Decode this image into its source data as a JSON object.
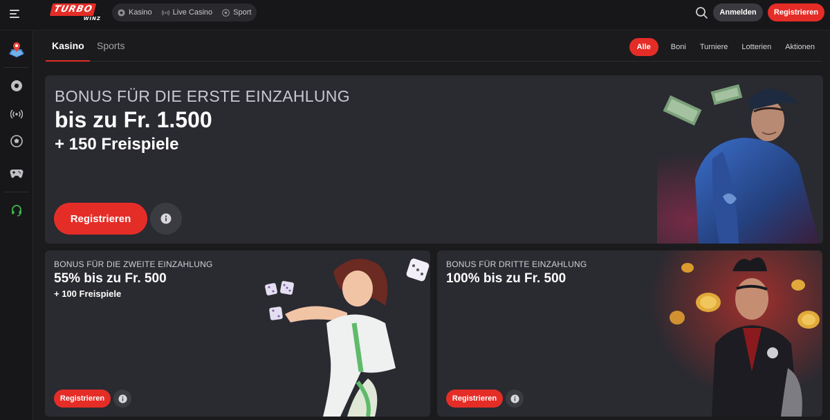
{
  "brand": {
    "logo_main": "TURBO",
    "logo_sub": "WINZ",
    "accent": "#e52d27"
  },
  "topnav": [
    {
      "label": "Kasino",
      "icon": "chip-icon"
    },
    {
      "label": "Live Casino",
      "icon": "broadcast-icon"
    },
    {
      "label": "Sport",
      "icon": "soccer-ball-icon"
    }
  ],
  "header": {
    "login_label": "Anmelden",
    "register_label": "Registrieren"
  },
  "sidebar": {
    "items": [
      {
        "icon": "map-pin-icon"
      },
      {
        "icon": "chip-icon"
      },
      {
        "icon": "broadcast-icon"
      },
      {
        "icon": "soccer-ball-icon"
      },
      {
        "icon": "gamepad-icon"
      },
      {
        "icon": "headset-icon"
      }
    ]
  },
  "tabs": {
    "kasino": "Kasino",
    "sports": "Sports"
  },
  "filters": [
    "Alle",
    "Boni",
    "Turniere",
    "Lotterien",
    "Aktionen"
  ],
  "banner": {
    "subtitle": "BONUS FÜR DIE ERSTE EINZAHLUNG",
    "title": "bis zu Fr. 1.500",
    "extra": "+ 150 Freispiele",
    "register_label": "Registrieren"
  },
  "cards": [
    {
      "subtitle": "BONUS FÜR DIE ZWEITE EINZAHLUNG",
      "title": "55% bis zu Fr. 500",
      "extra": "+ 100 Freispiele",
      "register_label": "Registrieren"
    },
    {
      "subtitle": "BONUS FÜR DRITTE EINZAHLUNG",
      "title": "100% bis zu Fr. 500",
      "register_label": "Registrieren"
    }
  ]
}
